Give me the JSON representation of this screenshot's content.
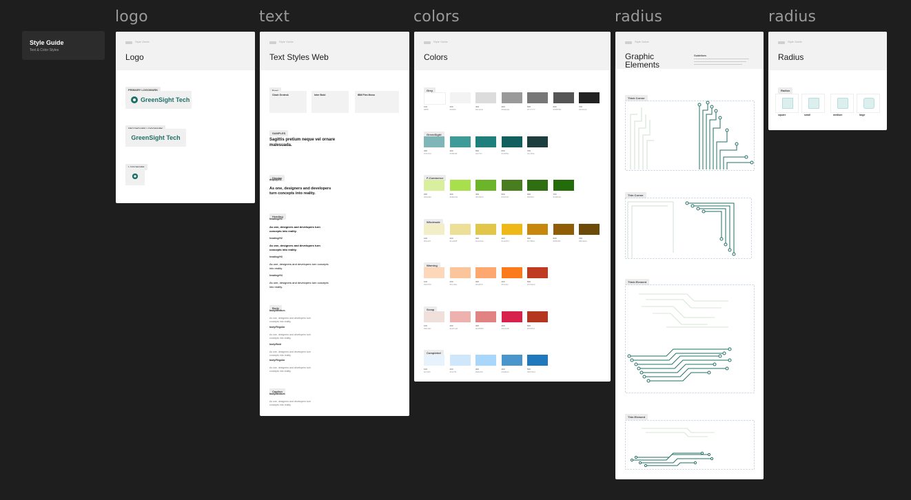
{
  "frame_labels": {
    "logo": "logo",
    "text": "text",
    "colors": "colors",
    "radius1": "radius",
    "radius2": "radius"
  },
  "style_guide": {
    "title": "Style Guide",
    "subtitle": "Text & Color Styles"
  },
  "crumb": "Style Guide",
  "logo": {
    "title": "Logo",
    "primary_label": "PRIMARY LOGOMARK",
    "secondary_label": "SECONDARY LOGOMARK",
    "logomark_label": "LOGOMARK",
    "brand_name": "GreenSight Tech",
    "brand_color": "#1f6f66"
  },
  "text_styles": {
    "title": "Text Styles Web",
    "font_chip": "Font",
    "cards": [
      "Clash Grotesk",
      "Inter Bold",
      "IBM Plex Mono"
    ],
    "sample_chip": "SAMPLES",
    "sample_heading": "Sagittis pretium neque vel ornare malesuada.",
    "display_chip": "Display",
    "display_name": "display/H1",
    "display_sample": "As one, designers and developers turn concepts into reality.",
    "heading_chip": "Heading",
    "heading_names": [
      "heading/H1",
      "heading/H2",
      "heading/H3",
      "heading/H4"
    ],
    "heading_sample": "As one, designers and developers turn concepts into reality.",
    "body_chip": "Body",
    "body_names": [
      "body/Medium",
      "body/Regular",
      "body/Bold",
      "body/Regular"
    ],
    "body_sample": "As one, designers and developers turn concepts into reality.",
    "caption_chip": "Caption",
    "caption_name": "body/Medium",
    "caption_sample": "As one, designers and developers turn concepts into reality."
  },
  "colors": {
    "title": "Colors",
    "groups": [
      {
        "name": "Grey",
        "swatches": [
          "#ffffff",
          "#f3f3f3",
          "#dcdcdc",
          "#9a9a9a",
          "#777777",
          "#555555",
          "#222222"
        ],
        "steps": [
          "100",
          "200",
          "300",
          "400",
          "500",
          "600",
          "700"
        ]
      },
      {
        "name": "GreenSight",
        "swatches": [
          "#7fb7b9",
          "#3f9b98",
          "#1f7f7c",
          "#125f5d",
          "#1c3f3e"
        ],
        "steps": [
          "300",
          "400",
          "500",
          "600",
          "700"
        ]
      },
      {
        "name": "F-Commerce",
        "swatches": [
          "#d9ef9d",
          "#a8e04d",
          "#6cb52b",
          "#4a7d1f",
          "#2f6f12",
          "#246b0c"
        ],
        "steps": [
          "200",
          "300",
          "400",
          "500",
          "600",
          "700"
        ]
      },
      {
        "name": "Wholesale",
        "swatches": [
          "#f2efc8",
          "#eedf98",
          "#e2c64a",
          "#eeb817",
          "#c7860c",
          "#8f5d06",
          "#6b4a0a"
        ],
        "steps": [
          "100",
          "200",
          "300",
          "400",
          "500",
          "600",
          "700"
        ]
      },
      {
        "name": "Warning",
        "swatches": [
          "#fdd7b9",
          "#fcc49a",
          "#fca870",
          "#fa7a1c",
          "#c03a22"
        ],
        "steps": [
          "100",
          "200",
          "300",
          "400",
          "500"
        ]
      },
      {
        "name": "Scrap",
        "swatches": [
          "#f0e0dc",
          "#eeb1ad",
          "#e28383",
          "#d7224b",
          "#b5361f"
        ],
        "steps": [
          "100",
          "200",
          "300",
          "400",
          "500"
        ]
      },
      {
        "name": "Completed",
        "swatches": [
          "#e7f2fc",
          "#cfe7fb",
          "#a8d7fb",
          "#4a96cc",
          "#2079bd"
        ],
        "steps": [
          "100",
          "200",
          "300",
          "400",
          "500"
        ]
      }
    ]
  },
  "graphics": {
    "title": "Graphic Elements",
    "notes_title": "Guidelines",
    "sections": [
      "Thick Corner",
      "Thin Corner",
      "Thick Element",
      "Thin Element"
    ]
  },
  "radius": {
    "title": "Radius",
    "chip": "Radius",
    "items": [
      "square",
      "small",
      "medium",
      "large"
    ]
  }
}
